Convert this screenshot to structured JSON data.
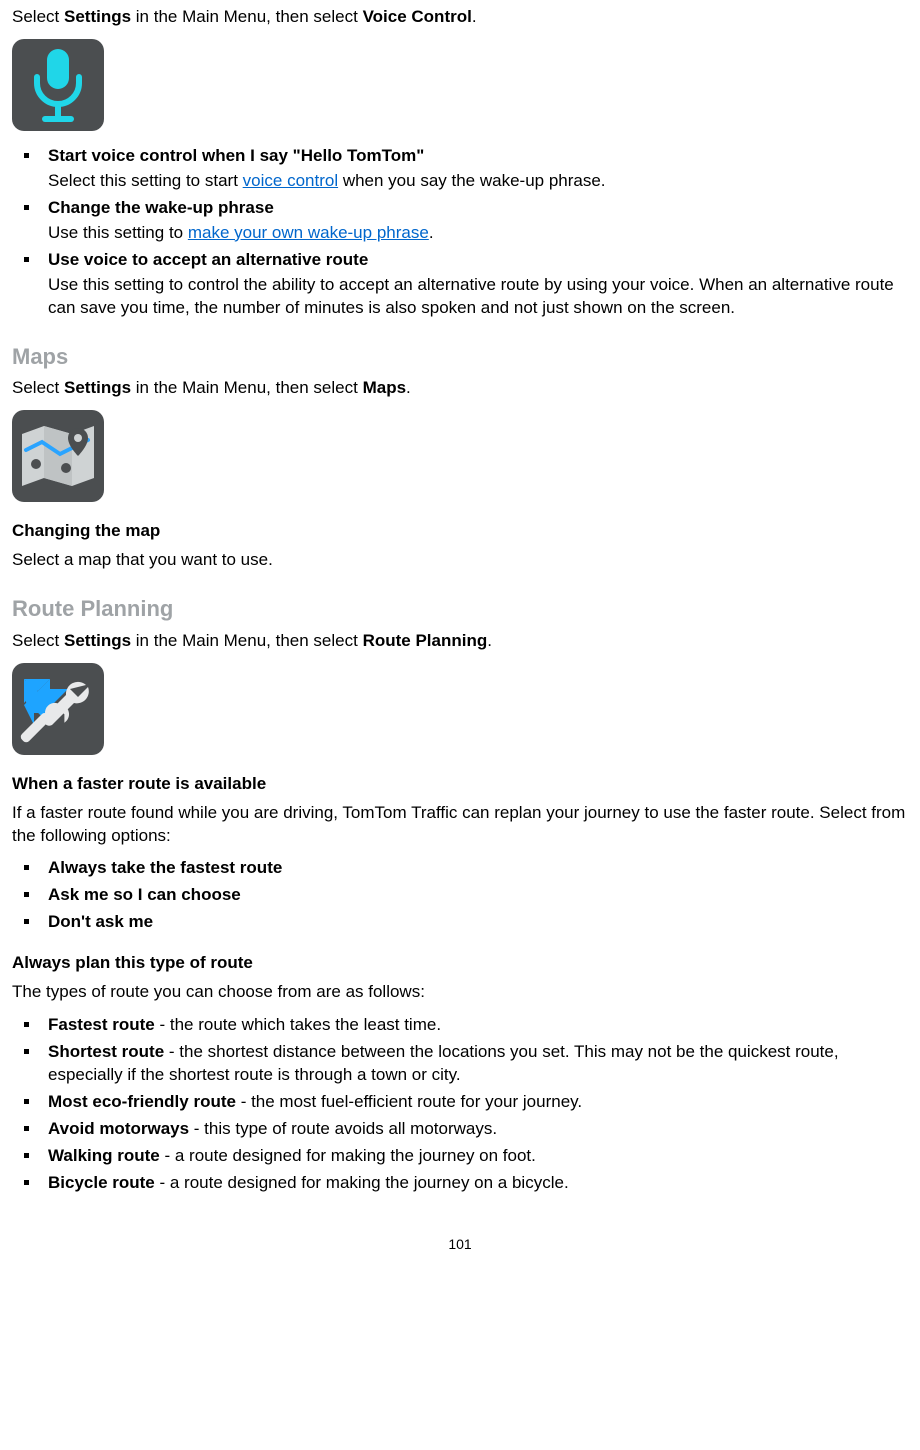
{
  "page_number": "101",
  "intro1": {
    "pre": "Select ",
    "b1": "Settings",
    "mid": " in the Main Menu, then select ",
    "b2": "Voice Control",
    "post": "."
  },
  "voice": {
    "item1": {
      "title": "Start voice control when I say \"Hello TomTom\"",
      "body_pre": "Select this setting to start ",
      "link": "voice control",
      "body_post": " when you say the wake-up phrase."
    },
    "item2": {
      "title": "Change the wake-up phrase",
      "body_pre": "Use this setting to ",
      "link": "make your own wake-up phrase",
      "body_post": "."
    },
    "item3": {
      "title": "Use voice to accept an alternative route",
      "body": "Use this setting to control the ability to accept an alternative route by using your voice. When an alternative route can save you time, the number of minutes is also spoken and not just shown on the screen."
    }
  },
  "maps": {
    "heading": "Maps",
    "intro": {
      "pre": "Select ",
      "b1": "Settings",
      "mid": " in the Main Menu, then select ",
      "b2": "Maps",
      "post": "."
    },
    "sub": "Changing the map",
    "body": "Select a map that you want to use."
  },
  "route": {
    "heading": "Route Planning",
    "intro": {
      "pre": "Select ",
      "b1": "Settings",
      "mid": " in the Main Menu, then select ",
      "b2": "Route Planning",
      "post": "."
    },
    "sub1": "When a faster route is available",
    "body1": "If a faster route found while you are driving, TomTom Traffic can replan your journey to use the faster route. Select from the following options:",
    "opts": {
      "o1": "Always take the fastest route",
      "o2": "Ask me so I can choose",
      "o3": "Don't ask me"
    },
    "sub2": "Always plan this type of route",
    "body2": "The types of route you can choose from are as follows:",
    "types": {
      "t1": {
        "b": "Fastest route",
        "d": " - the route which takes the least time."
      },
      "t2": {
        "b": "Shortest route",
        "d": " - the shortest distance between the locations you set. This may not be the quickest route, especially if the shortest route is through a town or city."
      },
      "t3": {
        "b": "Most eco-friendly route",
        "d": " - the most fuel-efficient route for your journey."
      },
      "t4": {
        "b": "Avoid motorways",
        "d": " - this type of route avoids all motorways."
      },
      "t5": {
        "b": "Walking route",
        "d": " - a route designed for making the journey on foot."
      },
      "t6": {
        "b": "Bicycle route",
        "d": " - a route designed for making the journey on a bicycle."
      }
    }
  }
}
